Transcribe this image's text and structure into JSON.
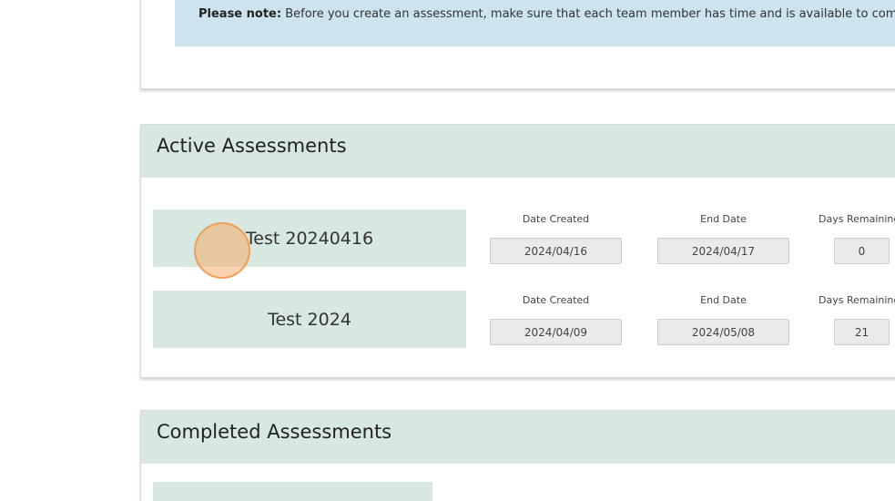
{
  "note": {
    "label": "Please note:",
    "text": " Before you create an assessment, make sure that each team member has time and is available to complete it."
  },
  "active": {
    "title": "Active Assessments",
    "assessments": [
      {
        "name": "Test 20240416",
        "date_created_label": "Date Created",
        "date_created": "2024/04/16",
        "end_date_label": "End Date",
        "end_date": "2024/04/17",
        "days_remaining_label": "Days Remaining",
        "days_remaining": "0"
      },
      {
        "name": "Test 2024",
        "date_created_label": "Date Created",
        "date_created": "2024/04/09",
        "end_date_label": "End Date",
        "end_date": "2024/05/08",
        "days_remaining_label": "Days Remaining",
        "days_remaining": "21"
      }
    ]
  },
  "completed": {
    "title": "Completed Assessments"
  },
  "colors": {
    "header_bg": "#d6e8df",
    "note_bg": "#cde3ee",
    "click_marker": "#f6ad6e"
  }
}
